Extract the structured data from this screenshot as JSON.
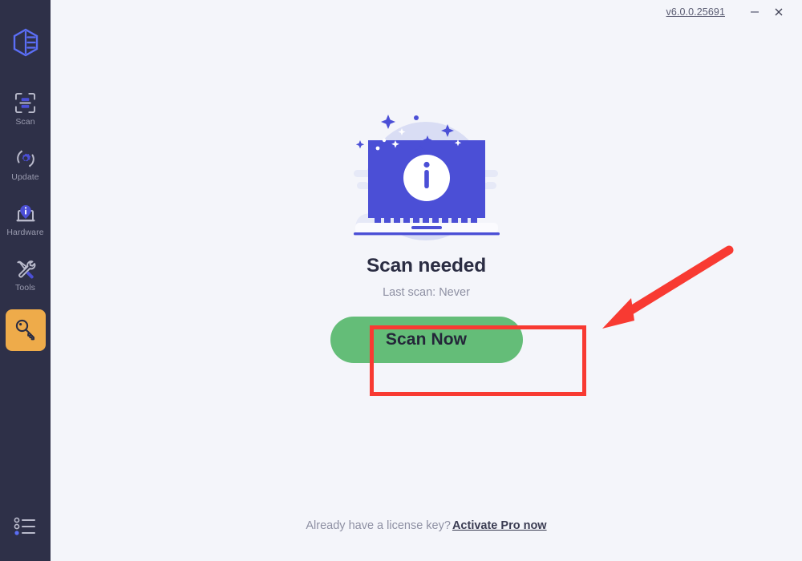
{
  "window": {
    "version": "v6.0.0.25691",
    "minimize_label": "─",
    "close_label": "✕"
  },
  "colors": {
    "sidebar_bg": "#2e3048",
    "page_bg": "#f4f5fa",
    "accent_blue": "#4b4fd6",
    "active_item_bg": "#eeab4a",
    "scan_button_bg": "#64bd78",
    "annotation_red": "#f83a32"
  },
  "sidebar": {
    "logo_name": "driver-booster-logo",
    "items": [
      {
        "label": "Scan",
        "icon": "scan-icon",
        "active": false
      },
      {
        "label": "Update",
        "icon": "update-icon",
        "active": false
      },
      {
        "label": "Hardware",
        "icon": "hardware-icon",
        "active": false
      },
      {
        "label": "Tools",
        "icon": "tools-icon",
        "active": false
      },
      {
        "label": "",
        "icon": "key-icon",
        "active": true
      }
    ],
    "bottom_icon": "menu-list-icon"
  },
  "main": {
    "illustration": "laptop-info-illustration",
    "status_title": "Scan needed",
    "status_subtitle": "Last scan: Never",
    "scan_button_label": "Scan Now"
  },
  "footer": {
    "prompt": "Already have a license key?",
    "link_label": "Activate Pro now"
  },
  "annotations": {
    "highlight_box_target": "scan-now-button",
    "arrow_points_to": "scan-now-button"
  }
}
